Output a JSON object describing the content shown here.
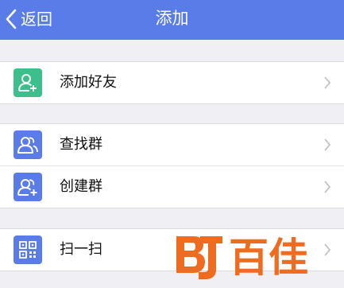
{
  "nav": {
    "back_label": "返回",
    "title": "添加"
  },
  "colors": {
    "nav_bar": "#5a7ce9",
    "icon_green": "#3cbf8b",
    "icon_blue": "#5a7ce9",
    "watermark_orange": "#ef6b1f"
  },
  "groups": [
    {
      "rows": [
        {
          "label": "添加好友",
          "icon": "add-friend-icon"
        }
      ]
    },
    {
      "rows": [
        {
          "label": "查找群",
          "icon": "find-group-icon"
        },
        {
          "label": "创建群",
          "icon": "create-group-icon"
        }
      ]
    },
    {
      "rows": [
        {
          "label": "扫一扫",
          "icon": "qr-scan-icon"
        }
      ]
    }
  ],
  "watermark": {
    "text": "百佳",
    "logo": "bj-logo-watermark"
  }
}
